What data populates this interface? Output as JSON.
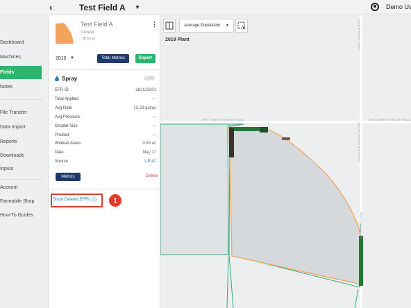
{
  "header": {
    "back_icon": "chevron-left-icon",
    "field_title": "Test Field A",
    "user_label": "Demo User"
  },
  "sidebar": {
    "items": [
      {
        "label": "Dashboard",
        "active": false
      },
      {
        "label": "Machines",
        "active": false
      },
      {
        "label": "Fields",
        "active": true
      },
      {
        "label": "Notes",
        "active": false
      },
      {
        "label": "File Transfer",
        "active": false
      },
      {
        "label": "Data Import",
        "active": false
      },
      {
        "label": "Reports",
        "active": false
      },
      {
        "label": "Downloads",
        "active": false
      },
      {
        "label": "Inputs",
        "active": false
      },
      {
        "label": "Account",
        "active": false
      },
      {
        "label": "Farmobile Shop",
        "active": false
      },
      {
        "label": "How-To Guides",
        "active": false
      }
    ]
  },
  "field": {
    "name": "Test Field A",
    "owner": "Grower",
    "acres": "36.53 ac"
  },
  "toolbar": {
    "year": "2019",
    "total_metrics_label": "Total Metrics",
    "export_label": "Export"
  },
  "efr": {
    "title": "Spray",
    "toggle_label": "OFF",
    "rows": [
      {
        "key": "EFR ID",
        "value": "abc123d01",
        "link": false
      },
      {
        "key": "Total Applied",
        "value": "---",
        "link": false
      },
      {
        "key": "Avg Rate",
        "value": "13.33 gal/ac",
        "link": false
      },
      {
        "key": "Avg Pressure",
        "value": "---",
        "link": false
      },
      {
        "key": "Droplet Size",
        "value": "---",
        "link": false
      },
      {
        "key": "Product",
        "value": "---",
        "link": false
      },
      {
        "key": "Worked Acres",
        "value": "0.93 ac",
        "link": false
      },
      {
        "key": "Date",
        "value": "May 17",
        "link": false
      },
      {
        "key": "Source",
        "value": "1 PUC",
        "link": true
      }
    ],
    "metrics_label": "Metrics",
    "delete_label": "Delete"
  },
  "show_deleted_label": "Show Deleted EFRs (1)",
  "callout_number": "1",
  "map": {
    "layer_select": "Average Population",
    "plant_label": "2019 Plant",
    "road_labels": {
      "top_horizontal": "WEST MAPLE GROVE ROAD",
      "right_horizontal": "WEST MAPLE GROVE ROAD",
      "top_vertical": "SOUTH RIDGE ROAD",
      "mid_vertical": "SOUTH RIDGEVIEW ROAD",
      "low_vertical": "SOUTH RIDGE RD"
    }
  },
  "colors": {
    "accent_green": "#2fb66d",
    "navy": "#1e3a6b",
    "field_orange": "#f2a45a",
    "highlight_red": "#e23b2e",
    "link_blue": "#2a7ab8"
  }
}
